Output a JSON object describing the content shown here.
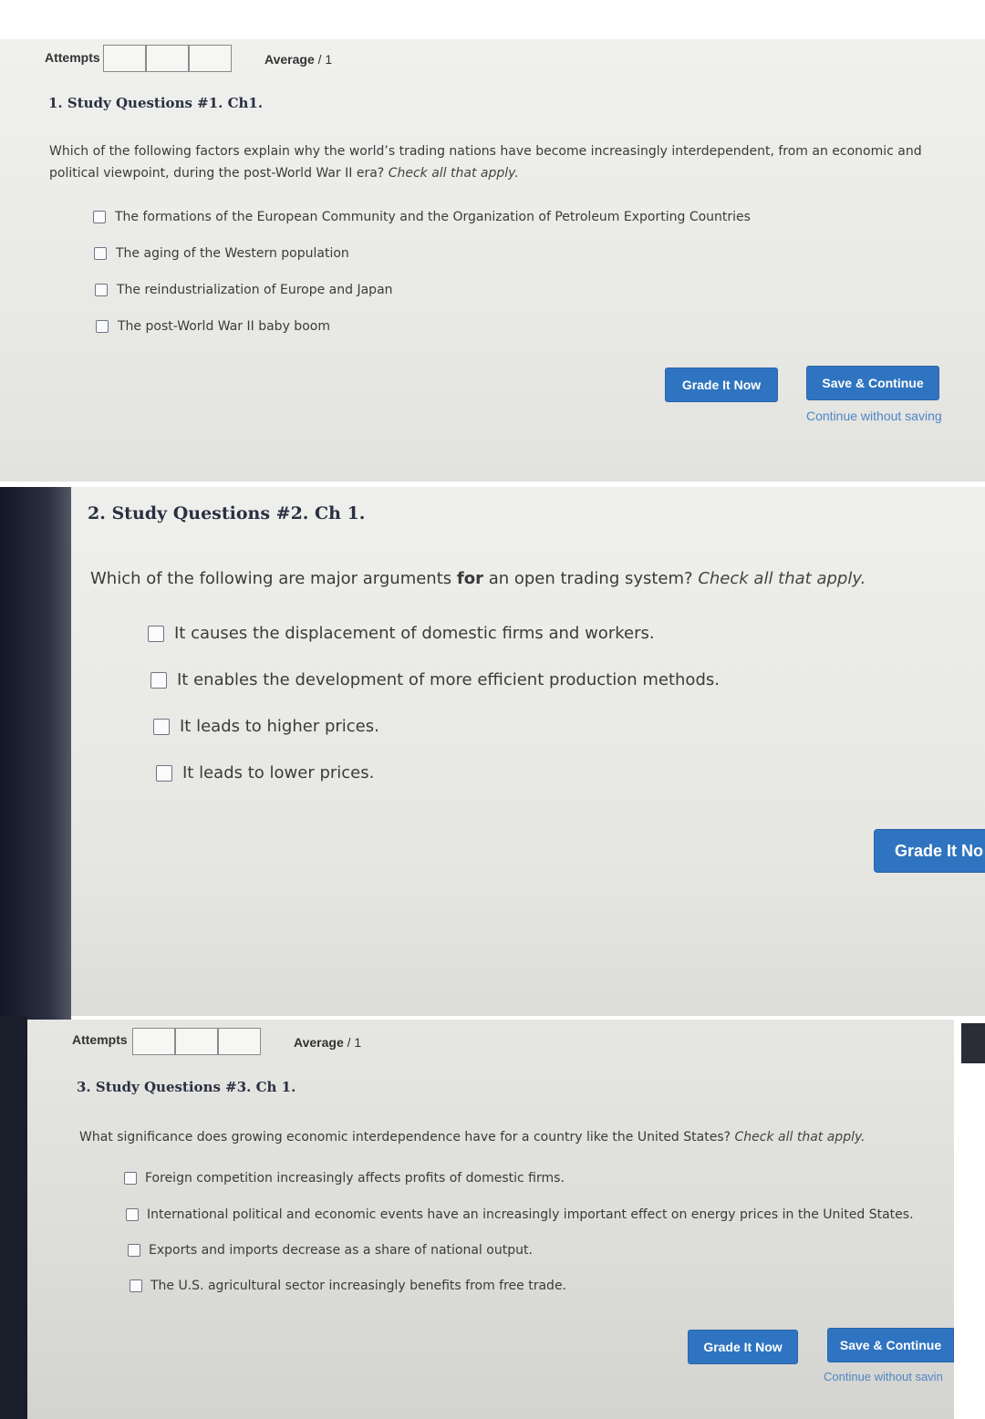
{
  "panels": [
    {
      "attempts_label": "Attempts",
      "average_label": "Average",
      "average_value": "/ 1",
      "title": "1. Study Questions #1. Ch1.",
      "question": "Which of the following factors explain why the world’s trading nations have become increasingly interdependent, from an economic and political viewpoint, during the post-World War II era?",
      "instruction": "Check all that apply.",
      "options": [
        "The formations of the European Community and the Organization of Petroleum Exporting Countries",
        "The aging of the Western population",
        "The reindustrialization of Europe and Japan",
        "The post-World War II baby boom"
      ],
      "grade_button": "Grade It Now",
      "save_button": "Save & Continue",
      "continue_link": "Continue without saving"
    },
    {
      "title": "2. Study Questions #2. Ch 1.",
      "question_pre": "Which of the following are major arguments",
      "question_bold": "for",
      "question_post": "an open trading system?",
      "instruction": "Check all that apply.",
      "options": [
        "It causes the displacement of domestic firms and workers.",
        "It enables the development of more efficient production methods.",
        "It leads to higher prices.",
        "It leads to lower prices."
      ],
      "grade_button": "Grade It No"
    },
    {
      "attempts_label": "Attempts",
      "average_label": "Average",
      "average_value": "/ 1",
      "title": "3. Study Questions #3. Ch 1.",
      "question": "What significance does growing economic interdependence have for a country like the United States?",
      "instruction": "Check all that apply.",
      "options": [
        "Foreign competition increasingly affects profits of domestic firms.",
        "International political and economic events have an increasingly important effect on energy prices in the United States.",
        "Exports and imports decrease as a share of national output.",
        "The U.S. agricultural sector increasingly benefits from free trade."
      ],
      "grade_button": "Grade It Now",
      "save_button": "Save & Continue",
      "continue_link": "Continue without savin"
    }
  ],
  "colors": {
    "button_blue": "#2f74c0",
    "link_blue": "#4f86c6",
    "title_text": "#2a3042"
  }
}
